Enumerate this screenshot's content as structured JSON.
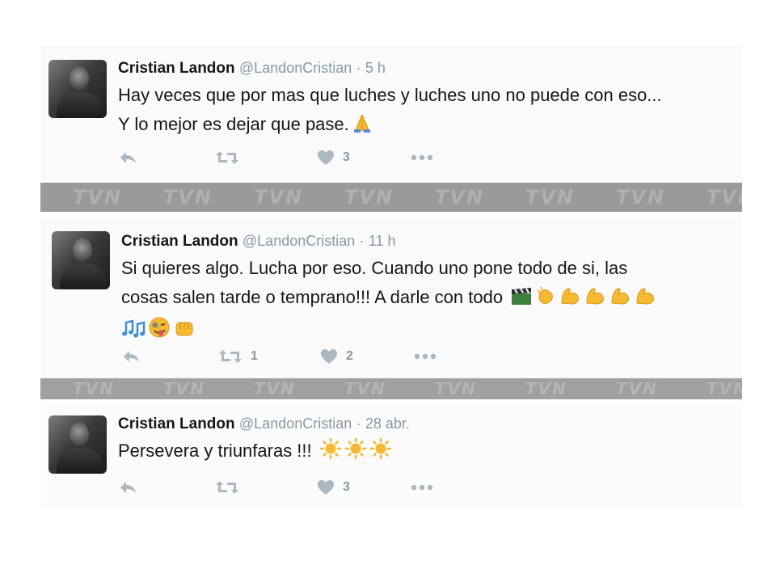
{
  "watermark": "TVN",
  "tweets": [
    {
      "name": "Cristian Landon",
      "handle": "@LandonCristian",
      "dot": "·",
      "time": "5 h",
      "lines": [
        "Hay veces que por mas que luches y luches uno no puede con eso...",
        "Y lo mejor es dejar que pase."
      ],
      "emoji_line1": [],
      "emoji_line2": [
        "folded-hands"
      ],
      "emoji_line3": [],
      "retweets": "",
      "likes": "3"
    },
    {
      "name": "Cristian Landon",
      "handle": "@LandonCristian",
      "dot": "·",
      "time": "11 h",
      "lines": [
        "Si quieres algo. Lucha por eso. Cuando uno pone todo de si, las",
        "cosas salen tarde o temprano!!! A darle con todo"
      ],
      "emoji_line2": [
        "clapper-board",
        "clapping-hands",
        "flexed-biceps",
        "flexed-biceps",
        "flexed-biceps",
        "flexed-biceps"
      ],
      "emoji_line3": [
        "musical-notes",
        "winking-tongue-face",
        "fist"
      ],
      "retweets": "1",
      "likes": "2"
    },
    {
      "name": "Cristian Landon",
      "handle": "@LandonCristian",
      "dot": "·",
      "time": "28 abr.",
      "lines": [
        "Persevera y triunfaras !!!"
      ],
      "emoji_line1": [
        "sun",
        "sun",
        "sun"
      ],
      "retweets": "",
      "likes": "3"
    }
  ],
  "colors": {
    "icon": "#aab8c2",
    "meta": "#8899a6",
    "emoji_yellow": "#f5b932",
    "band": "#9a9a9a"
  }
}
